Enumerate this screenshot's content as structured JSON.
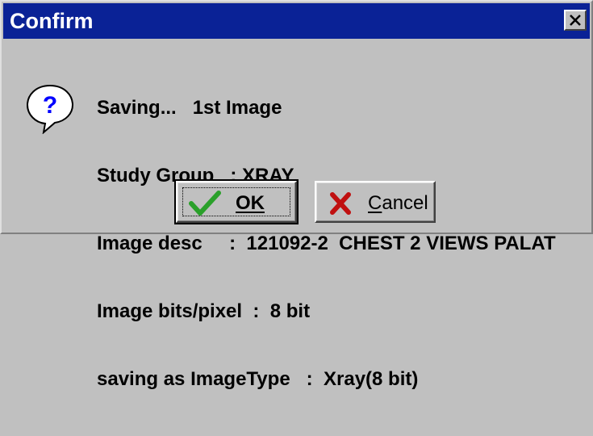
{
  "window": {
    "title": "Confirm"
  },
  "icons": {
    "close": "close-icon",
    "dialog": "question-icon",
    "ok": "check-icon",
    "cancel": "x-icon"
  },
  "colors": {
    "titlebar": "#0a2296",
    "face": "#c0c0c0",
    "question": "#0000ff",
    "check": "#2aa02a",
    "cancel_x": "#c01010"
  },
  "message": {
    "lines": [
      "Saving...   1st Image",
      "Study Group   : XRAY",
      "Image desc     :  121092-2  CHEST 2 VIEWS PALAT",
      "Image bits/pixel  :  8 bit",
      "saving as ImageType   :  Xray(8 bit)"
    ]
  },
  "buttons": {
    "ok_label": "OK",
    "cancel_first": "C",
    "cancel_rest": "ancel"
  }
}
